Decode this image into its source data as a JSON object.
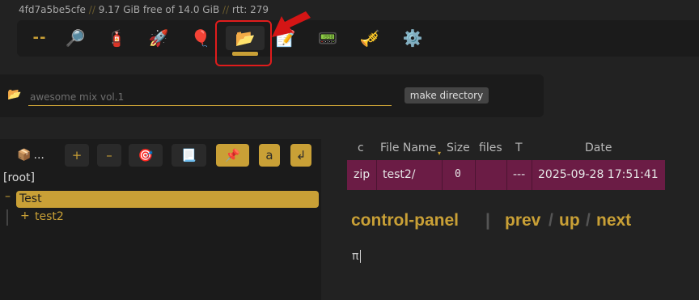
{
  "status": {
    "host": "4fd7a5be5cfe",
    "sep": "//",
    "free": "9.17 GiB free of 14.0 GiB",
    "rtt": "rtt: 279"
  },
  "opbar": {
    "items": [
      {
        "name": "ops-toggle",
        "glyph": "--"
      },
      {
        "name": "search-icon",
        "glyph": "🔎"
      },
      {
        "name": "unpost-icon",
        "glyph": "🧯"
      },
      {
        "name": "upload-icon",
        "glyph": "🚀"
      },
      {
        "name": "bup-icon",
        "glyph": "🎈"
      },
      {
        "name": "mkdir-folder-icon",
        "glyph": "📂"
      },
      {
        "name": "new-file-icon",
        "glyph": "📝"
      },
      {
        "name": "msg-icon",
        "glyph": "📟"
      },
      {
        "name": "player-icon",
        "glyph": "🎺"
      },
      {
        "name": "settings-icon",
        "glyph": "⚙️"
      }
    ]
  },
  "mkdir": {
    "folder_glyph": "📂",
    "placeholder": "awesome mix vol.1",
    "button": "make directory"
  },
  "tree": {
    "toolbar": {
      "pkg": "📦",
      "ellipsis": "...",
      "plus": "+",
      "minus": "–",
      "target": "🎯",
      "doc": "📃",
      "pin": "📌",
      "a": "a",
      "enter": "↲"
    },
    "root": "[root]",
    "selected": "Test",
    "collapse": "–",
    "expand": "+",
    "child": "test2"
  },
  "files": {
    "headers": [
      "c",
      "File Name",
      "Size",
      "files",
      "T",
      "Date"
    ],
    "sort_indicator": "▾",
    "rows": [
      {
        "c": "zip",
        "name": "test2/",
        "size": "0",
        "files": "",
        "t": "---",
        "date": "2025-09-28 17:51:41"
      }
    ]
  },
  "nav": {
    "title": "control-panel",
    "bar": "|",
    "prev": "prev",
    "up": "up",
    "next": "next",
    "slash": "/"
  },
  "doc": {
    "text": "π"
  },
  "colors": {
    "accent": "#c9a036",
    "row_bg": "#6b1c45",
    "highlight": "#e01c1c",
    "bg": "#222222"
  }
}
